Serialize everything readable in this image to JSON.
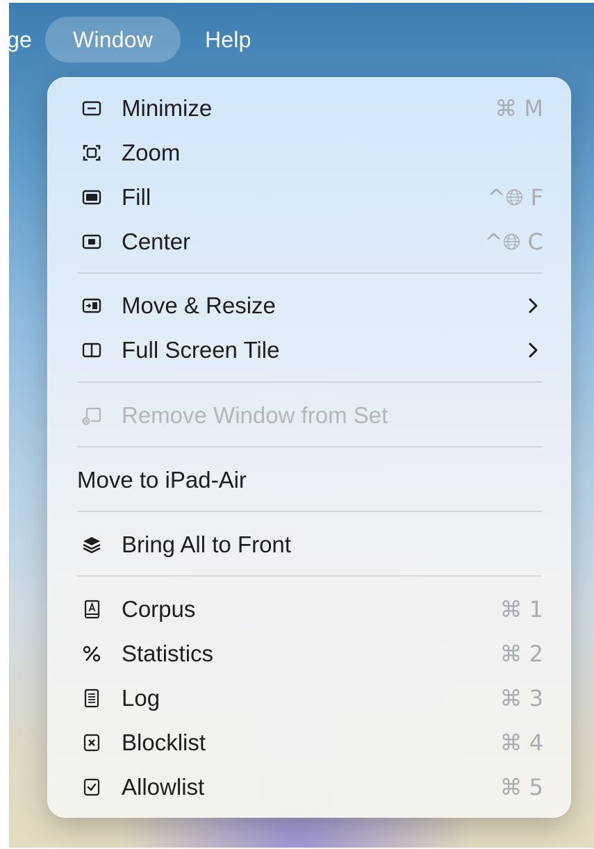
{
  "menubar": {
    "partial_label": "ge",
    "window_label": "Window",
    "help_label": "Help"
  },
  "menu": {
    "minimize": {
      "label": "Minimize",
      "shortcut": "⌘ M",
      "icon": "minimize-icon"
    },
    "zoom": {
      "label": "Zoom",
      "icon": "zoom-icon"
    },
    "fill": {
      "label": "Fill",
      "shortcut": "^🌐︎ F",
      "icon": "fill-icon"
    },
    "center": {
      "label": "Center",
      "shortcut": "^🌐︎ C",
      "icon": "center-icon"
    },
    "move_resize": {
      "label": "Move & Resize",
      "icon": "move-resize-icon",
      "submenu": true
    },
    "full_screen_tile": {
      "label": "Full Screen Tile",
      "icon": "split-view-icon",
      "submenu": true
    },
    "remove_window": {
      "label": "Remove Window from Set",
      "icon": "remove-window-icon",
      "disabled": true
    },
    "move_to_ipad": {
      "label": "Move to iPad-Air"
    },
    "bring_all": {
      "label": "Bring All to Front",
      "icon": "stack-icon"
    },
    "corpus": {
      "label": "Corpus",
      "shortcut": "⌘ 1",
      "icon": "book-icon"
    },
    "statistics": {
      "label": "Statistics",
      "shortcut": "⌘ 2",
      "icon": "percent-icon"
    },
    "log": {
      "label": "Log",
      "shortcut": "⌘ 3",
      "icon": "receipt-icon"
    },
    "blocklist": {
      "label": "Blocklist",
      "shortcut": "⌘ 4",
      "icon": "xmark-square-icon"
    },
    "allowlist": {
      "label": "Allowlist",
      "shortcut": "⌘ 5",
      "icon": "checkmark-square-icon"
    }
  }
}
